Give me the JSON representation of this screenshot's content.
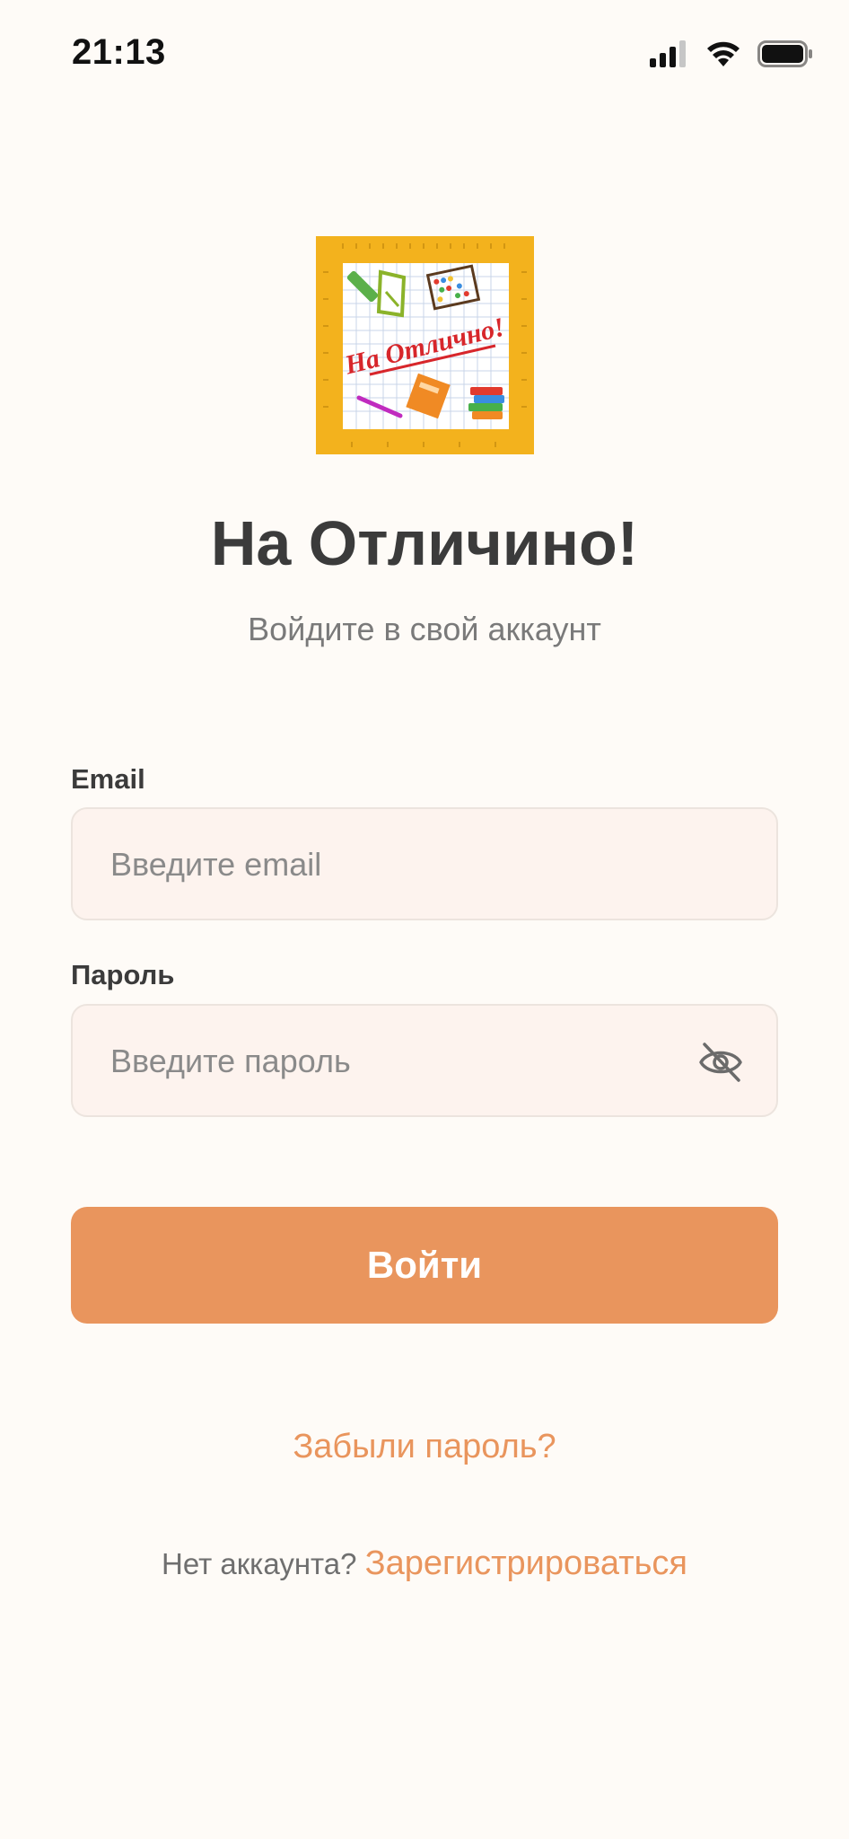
{
  "status_bar": {
    "time": "21:13"
  },
  "logo": {
    "text": "На Отлично!"
  },
  "header": {
    "title": "На Отличино!",
    "subtitle": "Войдите в свой аккаунт"
  },
  "form": {
    "email_label": "Email",
    "email_placeholder": "Введите email",
    "password_label": "Пароль",
    "password_placeholder": "Введите пароль",
    "login_button": "Войти"
  },
  "links": {
    "forgot_password": "Забыли пароль?",
    "no_account": "Нет аккаунта?",
    "register": "Зарегистрироваться"
  },
  "colors": {
    "accent": "#e9955d",
    "background": "#fefbf7",
    "field_bg": "#fdf3ee"
  }
}
